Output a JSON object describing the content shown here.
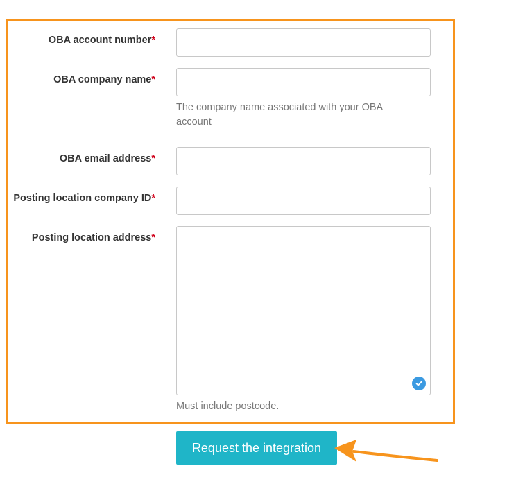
{
  "form": {
    "fields": [
      {
        "label": "OBA account number",
        "required_mark": "*",
        "value": ""
      },
      {
        "label": "OBA company name",
        "required_mark": "*",
        "value": "",
        "help": "The company name associated with your OBA account"
      },
      {
        "label": "OBA email address",
        "required_mark": "*",
        "value": ""
      },
      {
        "label": "Posting location company ID",
        "required_mark": "*",
        "value": ""
      },
      {
        "label": "Posting location address",
        "required_mark": "*",
        "value": "",
        "help": "Must include postcode."
      }
    ],
    "submit_label": "Request the integration"
  },
  "colors": {
    "highlight_border": "#f7941d",
    "arrow": "#f7941d",
    "button": "#1fb5c8",
    "required": "#d0021b",
    "badge": "#3b9ae1"
  },
  "icons": {
    "textarea_badge": "check-circle-icon",
    "annotation": "pointer-arrow-icon"
  }
}
